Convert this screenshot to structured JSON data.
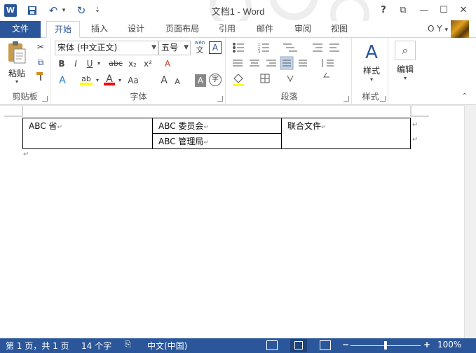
{
  "titlebar": {
    "title": "文档1 - Word",
    "app_icon": "W",
    "help": "?",
    "restore_ribbon": "⧉",
    "minimize": "—",
    "maximize": "☐",
    "close": "✕"
  },
  "qat": {
    "save": "💾",
    "undo": "↶",
    "undo_drop": "▾",
    "redo": "↻",
    "customize": "⇣"
  },
  "tabs": [
    "文件",
    "开始",
    "插入",
    "设计",
    "页面布局",
    "引用",
    "邮件",
    "审阅",
    "视图"
  ],
  "user": {
    "name": "O Y",
    "chevron": "▾"
  },
  "ribbon": {
    "clipboard": {
      "label": "剪贴板",
      "paste": "粘贴",
      "cut_icon": "✂",
      "copy_icon": "⧉",
      "painter_icon": "🖌"
    },
    "font": {
      "label": "字体",
      "font_name": "宋体 (中文正文)",
      "font_size": "五号",
      "wen": "wén",
      "wen_char": "文",
      "charborder": "A",
      "bold": "B",
      "italic": "I",
      "underline": "U",
      "strike": "abc",
      "sub": "x₂",
      "sup": "x²",
      "clear": "A",
      "effects": "A",
      "highlight": "ab",
      "fontcolor": "A",
      "case": "Aa",
      "grow": "A",
      "shrink": "A",
      "shade": "A",
      "enclose": "字"
    },
    "paragraph": {
      "label": "段落"
    },
    "styles": {
      "label": "样式",
      "button": "样式"
    },
    "editing": {
      "button": "编辑"
    }
  },
  "document": {
    "table": {
      "r1c1": "ABC 省",
      "r1c2": "ABC 委员会",
      "r2c2": "ABC 管理局",
      "r1c3": "联合文件"
    },
    "para_mark": "↵"
  },
  "statusbar": {
    "page": "第 1 页，共 1 页",
    "words": "14 个字",
    "proof_icon": "📖",
    "language": "中文(中国)",
    "zoom_minus": "−",
    "zoom_plus": "+",
    "zoom": "100%",
    "zoom_level": 100
  },
  "colors": {
    "accent": "#2b579a",
    "highlight": "#ffff00",
    "font_color": "#ff0000"
  }
}
